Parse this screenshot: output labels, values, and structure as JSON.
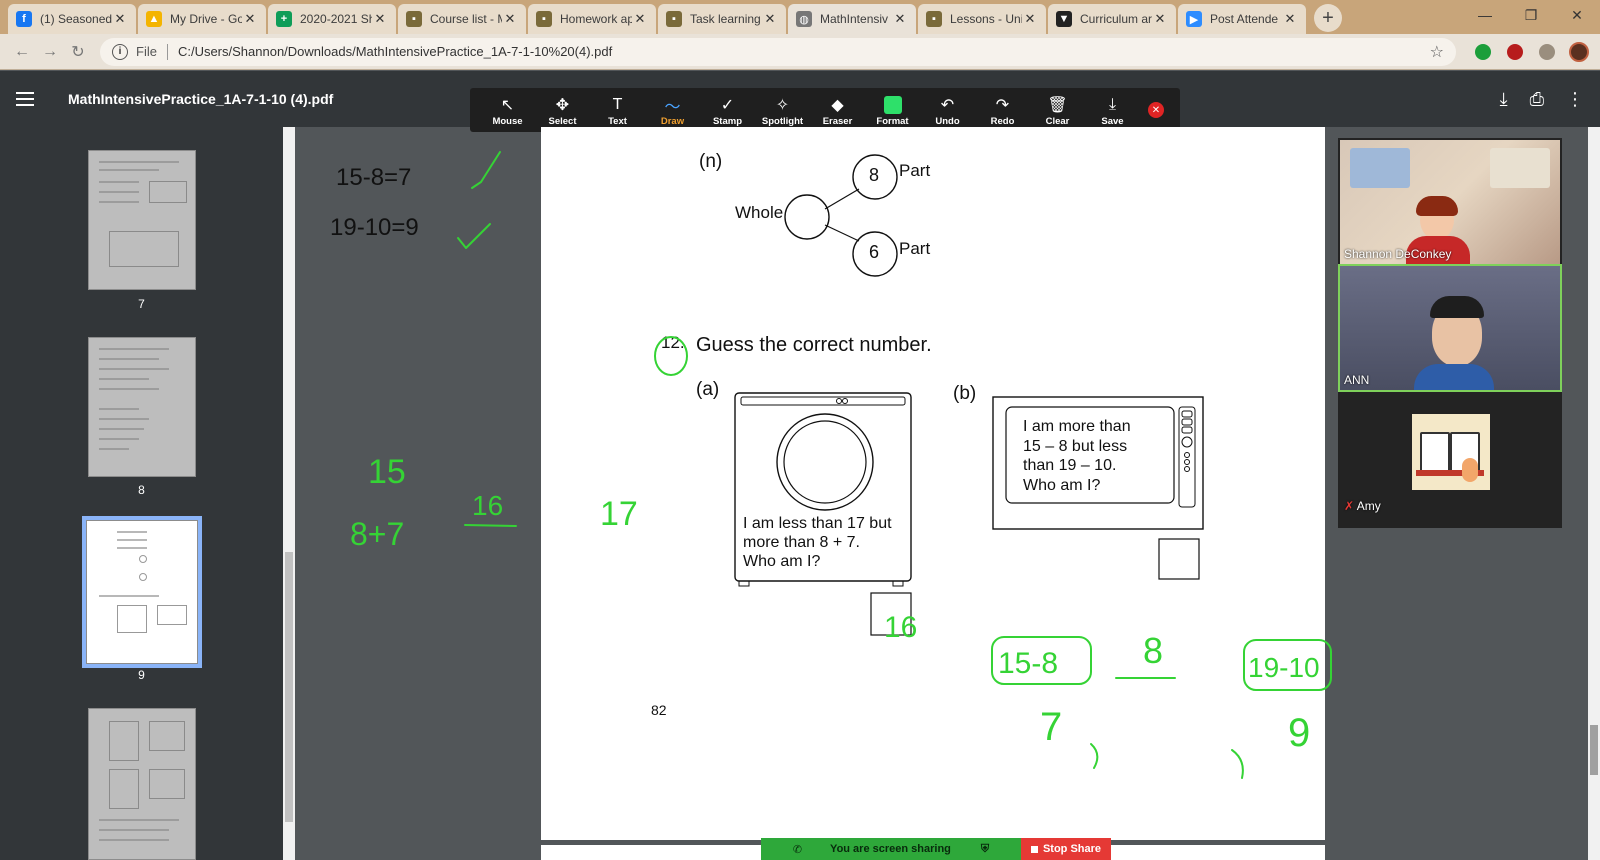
{
  "browser": {
    "tabs": [
      {
        "title": "(1) Seasoned",
        "icon": "facebook-icon",
        "color": "#1877f2",
        "glyph": "f"
      },
      {
        "title": "My Drive - Go",
        "icon": "google-drive-icon",
        "color": "#f4b400",
        "glyph": "▲"
      },
      {
        "title": "2020-2021 Sh",
        "icon": "google-sheets-icon",
        "color": "#0f9d58",
        "glyph": "+"
      },
      {
        "title": "Course list - M",
        "icon": "schoology-icon",
        "color": "#7a6a3a",
        "glyph": "▪"
      },
      {
        "title": "Homework ap",
        "icon": "schoology-icon",
        "color": "#7a6a3a",
        "glyph": "▪"
      },
      {
        "title": "Task learning",
        "icon": "schoology-icon",
        "color": "#7a6a3a",
        "glyph": "▪"
      },
      {
        "title": "MathIntensiv",
        "icon": "globe-icon",
        "color": "#777777",
        "glyph": "◍"
      },
      {
        "title": "Lessons - Uni",
        "icon": "schoology-icon",
        "color": "#7a6a3a",
        "glyph": "▪"
      },
      {
        "title": "Curriculum ar",
        "icon": "shield-icon",
        "color": "#222222",
        "glyph": "▼"
      },
      {
        "title": "Post Attende",
        "icon": "zoom-icon",
        "color": "#2d8cff",
        "glyph": "▶"
      }
    ],
    "active_tab": 6,
    "url_prefix": "File",
    "url": "C:/Users/Shannon/Downloads/MathIntensivePractice_1A-7-1-10%20(4).pdf"
  },
  "pdf": {
    "title": "MathIntensivePractice_1A-7-1-10 (4).pdf",
    "thumbnails": [
      {
        "page": "7"
      },
      {
        "page": "8"
      },
      {
        "page": "9",
        "current": true
      },
      {
        "page": ""
      }
    ]
  },
  "annotation_toolbar": {
    "tools": [
      {
        "label": "Mouse",
        "icon": "cursor-icon",
        "glyph": "↖"
      },
      {
        "label": "Select",
        "icon": "move-icon",
        "glyph": "✥"
      },
      {
        "label": "Text",
        "icon": "text-icon",
        "glyph": "T"
      },
      {
        "label": "Draw",
        "icon": "draw-icon",
        "glyph": "〜",
        "selected": true
      },
      {
        "label": "Stamp",
        "icon": "stamp-icon",
        "glyph": "✓"
      },
      {
        "label": "Spotlight",
        "icon": "spotlight-icon",
        "glyph": "✧"
      },
      {
        "label": "Eraser",
        "icon": "eraser-icon",
        "glyph": "◆"
      },
      {
        "label": "Format",
        "icon": "format-icon",
        "glyph": ""
      },
      {
        "label": "Undo",
        "icon": "undo-icon",
        "glyph": "↶"
      },
      {
        "label": "Redo",
        "icon": "redo-icon",
        "glyph": "↷"
      },
      {
        "label": "Clear",
        "icon": "trash-icon",
        "glyph": "🗑"
      },
      {
        "label": "Save",
        "icon": "save-icon",
        "glyph": "⤓"
      }
    ],
    "format_color": "#2ee06a"
  },
  "document": {
    "part_n_label": "(n)",
    "whole_label": "Whole",
    "part_label_1": "Part",
    "part_label_2": "Part",
    "part_value_1": "8",
    "part_value_2": "6",
    "q12_number": "12.",
    "q12_title": "Guess the correct number.",
    "a_label": "(a)",
    "b_label": "(b)",
    "a_text": [
      "I am less than 17 but",
      "more than 8 + 7.",
      "Who am I?"
    ],
    "b_text": [
      "I am more than",
      "15 – 8 but less",
      "than 19 – 10.",
      "Who am I?"
    ],
    "page_number": "82"
  },
  "annotations": {
    "color": "#35d335",
    "margin_eq_1": "15-8=7",
    "margin_eq_2": "19-10=9",
    "hand_15": "15",
    "hand_8_7": "8+7",
    "hand_16": "16",
    "hand_17": "17",
    "answer_a": "16",
    "b_left_box": "15-8",
    "b_middle": "8",
    "b_right_box": "19-10",
    "b_left_result": "7",
    "b_right_result": "9"
  },
  "zoom": {
    "participants": [
      {
        "name": "Shannon DeConkey"
      },
      {
        "name": "ANN"
      },
      {
        "name": "Amy"
      }
    ],
    "sharing_text": "You are screen sharing",
    "stop_share": "Stop Share"
  }
}
